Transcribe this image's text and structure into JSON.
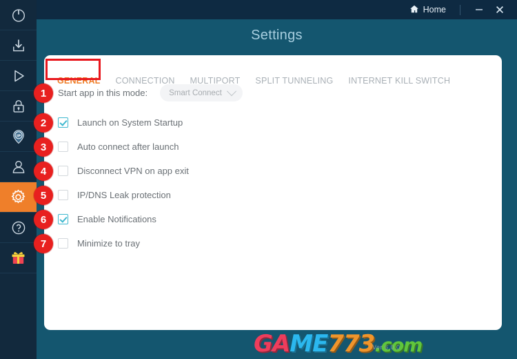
{
  "window": {
    "title": "Settings",
    "home_label": "Home",
    "home_icon": "home-icon",
    "minimize_icon": "minimize-icon",
    "close_icon": "close-icon"
  },
  "sidebar": {
    "items": [
      {
        "icon": "power-icon",
        "name": "sidebar-item-power",
        "active": false
      },
      {
        "icon": "download-icon",
        "name": "sidebar-item-download",
        "active": false
      },
      {
        "icon": "play-icon",
        "name": "sidebar-item-play",
        "active": false
      },
      {
        "icon": "lock-icon",
        "name": "sidebar-item-lock",
        "active": false
      },
      {
        "icon": "ip-pin-icon",
        "name": "sidebar-item-ip",
        "active": false
      },
      {
        "icon": "user-icon",
        "name": "sidebar-item-account",
        "active": false
      },
      {
        "icon": "gear-icon",
        "name": "sidebar-item-settings",
        "active": true
      },
      {
        "icon": "help-icon",
        "name": "sidebar-item-help",
        "active": false
      },
      {
        "icon": "gift-icon",
        "name": "sidebar-item-gift",
        "active": false
      }
    ]
  },
  "tabs": [
    {
      "label": "GENERAL",
      "active": true
    },
    {
      "label": "CONNECTION",
      "active": false
    },
    {
      "label": "MULTIPORT",
      "active": false
    },
    {
      "label": "SPLIT TUNNELING",
      "active": false
    },
    {
      "label": "INTERNET KILL SWITCH",
      "active": false
    }
  ],
  "general": {
    "mode_label": "Start app in this mode:",
    "mode_value": "Smart Connect",
    "mode_placeholder": "Smart Connect",
    "options": [
      {
        "label": "Launch on System Startup",
        "checked": true
      },
      {
        "label": "Auto connect after launch",
        "checked": false
      },
      {
        "label": "Disconnect VPN on app exit",
        "checked": false
      },
      {
        "label": "IP/DNS Leak protection",
        "checked": false
      },
      {
        "label": "Enable Notifications",
        "checked": true
      },
      {
        "label": "Minimize to tray",
        "checked": false
      }
    ]
  },
  "annotations": {
    "badges": [
      "1",
      "2",
      "3",
      "4",
      "5",
      "6",
      "7"
    ],
    "highlight_color": "#e8171d",
    "badge_color": "#e8201f"
  },
  "watermark": {
    "part1": "G",
    "part2": "A",
    "part3": "M",
    "part4": "E",
    "part5": "773",
    "part6": ".com",
    "version": "Ver 6.0.0"
  },
  "colors": {
    "accent": "#ef7f2a",
    "sidebar_bg": "#12293d",
    "content_bg": "#14566f",
    "topbar_bg": "#0e2a42",
    "checkbox_on": "#3fb8cf"
  }
}
